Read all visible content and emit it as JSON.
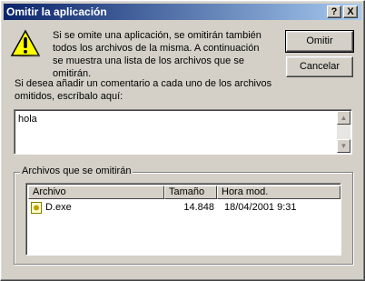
{
  "window": {
    "title": "Omitir la aplicación"
  },
  "titlebar": {
    "help_label": "?",
    "close_label": "X"
  },
  "message": "Si se omite una aplicación, se omitirán también todos los archivos de la misma. A continuación se muestra una lista de los archivos que se omitirán.",
  "buttons": {
    "ok": "Omitir",
    "cancel": "Cancelar"
  },
  "comment": {
    "prompt": "Si desea añadir un comentario a cada uno de los archivos omitidos, escríbalo aquí:",
    "value": "hola"
  },
  "files_group": {
    "label": "Archivos que se omitirán",
    "columns": {
      "file": "Archivo",
      "size": "Tamaño",
      "modified": "Hora mod."
    },
    "rows": [
      {
        "file": "D.exe",
        "size": "14.848",
        "modified": "18/04/2001 9:31"
      }
    ]
  },
  "icons": {
    "warning": "warning-icon",
    "file": "file-icon"
  }
}
